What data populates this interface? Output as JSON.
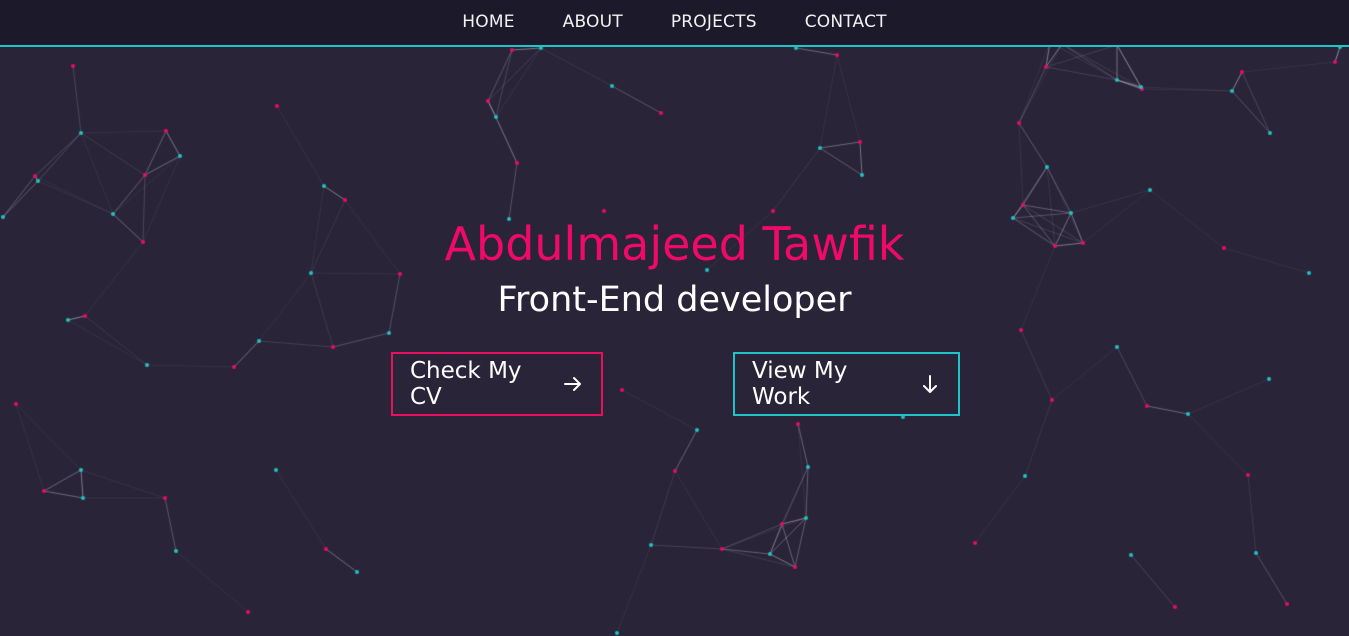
{
  "nav": {
    "items": [
      {
        "label": "HOME"
      },
      {
        "label": "ABOUT"
      },
      {
        "label": "PROJECTS"
      },
      {
        "label": "CONTACT"
      }
    ]
  },
  "hero": {
    "name": "Abdulmajeed Tawfik",
    "role": "Front-End developer",
    "cv_button": {
      "label": "Check My CV",
      "icon": "arrow-right-icon"
    },
    "work_button": {
      "label": "View My Work",
      "icon": "arrow-down-icon"
    }
  },
  "colors": {
    "background": "#2a2438",
    "navbar": "#1c1a2a",
    "accent_pink": "#ef0a6a",
    "accent_cyan": "#1ec4c8",
    "text": "#ffffff"
  }
}
